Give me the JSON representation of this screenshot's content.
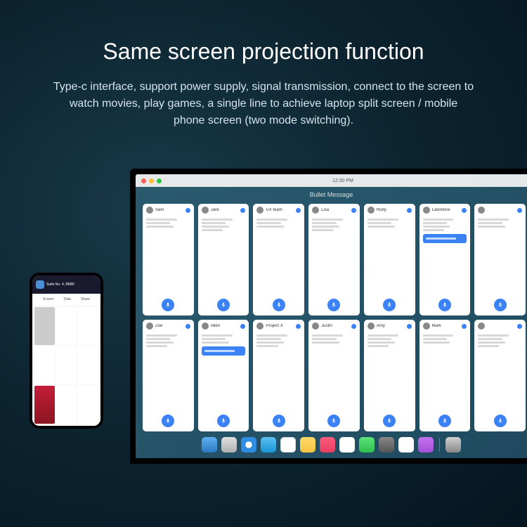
{
  "title": "Same screen projection function",
  "description": "Type-c interface, support power supply, signal transmission, connect to the screen to watch movies, play games, a single line to achieve laptop split screen / mobile phone screen (two mode switching).",
  "phone": {
    "nowPlaying": "Suite No. 4, BMW",
    "tabs": [
      "Screen",
      "Data",
      "Share"
    ]
  },
  "monitor": {
    "clock": "12:30 PM",
    "windowTitle": "Bullet Message",
    "contacts": [
      {
        "name": "Sam"
      },
      {
        "name": "Jack"
      },
      {
        "name": "UX team"
      },
      {
        "name": "Lisa"
      },
      {
        "name": "Ruby"
      },
      {
        "name": "Lawrence"
      },
      {
        "name": ""
      },
      {
        "name": "Zoe"
      },
      {
        "name": "Allen"
      },
      {
        "name": "Project X"
      },
      {
        "name": "Justin"
      },
      {
        "name": "Amy"
      },
      {
        "name": "Mark"
      },
      {
        "name": ""
      }
    ]
  }
}
